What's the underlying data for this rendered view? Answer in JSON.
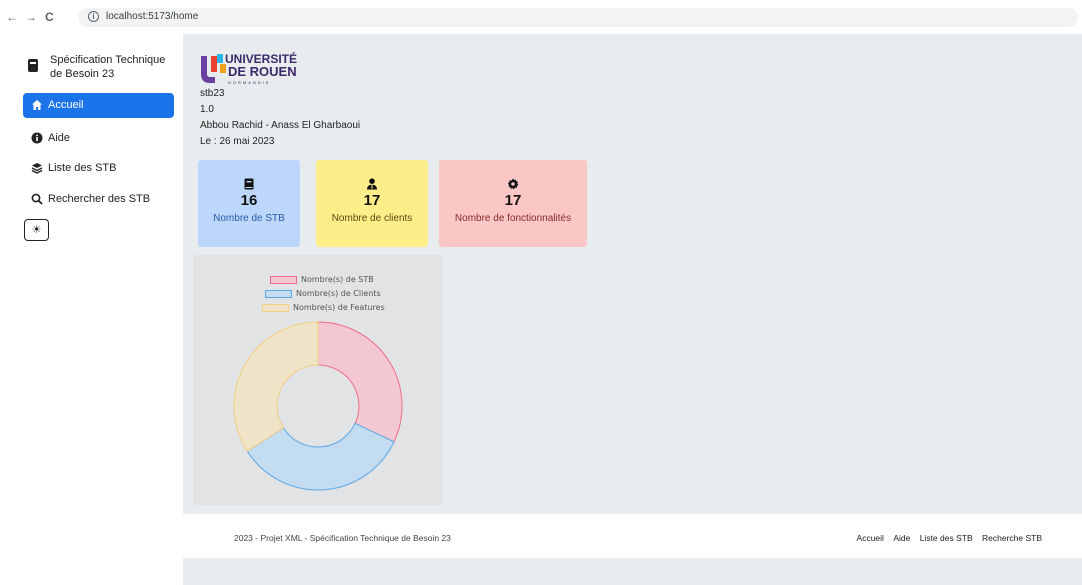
{
  "browser": {
    "url": "localhost:5173/home",
    "back": "←",
    "forward": "→",
    "reload": "C",
    "info": "i"
  },
  "sidebar": {
    "brand": "Spécification Technique de Besoin 23",
    "items": [
      {
        "label": "Accueil",
        "icon": "home-icon",
        "active": true
      },
      {
        "label": "Aide",
        "icon": "info-icon",
        "active": false
      },
      {
        "label": "Liste des STB",
        "icon": "layers-icon",
        "active": false
      },
      {
        "label": "Rechercher des STB",
        "icon": "search-icon",
        "active": false
      }
    ],
    "theme_toggle": "☀"
  },
  "main": {
    "logo_text": {
      "line1": "UNIVERSITÉ",
      "line2": "DE ROUEN",
      "line3": "NORMANDIE"
    },
    "info": {
      "title": "stb23",
      "version": "1.0",
      "authors": "Abbou Rachid - Anass El Gharbaoui",
      "date": "Le : 26 mai 2023"
    },
    "cards": [
      {
        "value": "16",
        "label": "Nombre de STB",
        "icon": "book-icon",
        "color": "#bcd7fb"
      },
      {
        "value": "17",
        "label": "Nombre de clients",
        "icon": "user-icon",
        "color": "#fdee8a"
      },
      {
        "value": "17",
        "label": "Nombre de fonctionnalités",
        "icon": "gear-icon",
        "color": "#fbc7c6"
      }
    ]
  },
  "chart_data": {
    "type": "pie",
    "variant": "doughnut",
    "series": [
      {
        "name": "Nombre(s) de STB",
        "value": 16,
        "fill": "#f4c8d2",
        "stroke": "#ef6a88"
      },
      {
        "name": "Nombre(s) de Clients",
        "value": 17,
        "fill": "#c4dcf2",
        "stroke": "#5aa8e6"
      },
      {
        "name": "Nombre(s) de Features",
        "value": 17,
        "fill": "#efe3c8",
        "stroke": "#f2cf80"
      }
    ],
    "legend_position": "top"
  },
  "footer": {
    "copyright": "2023 - Projet XML - Spécification Technique de Besoin 23",
    "links": [
      "Accueil",
      "Aide",
      "Liste des STB",
      "Recherche STB"
    ]
  }
}
